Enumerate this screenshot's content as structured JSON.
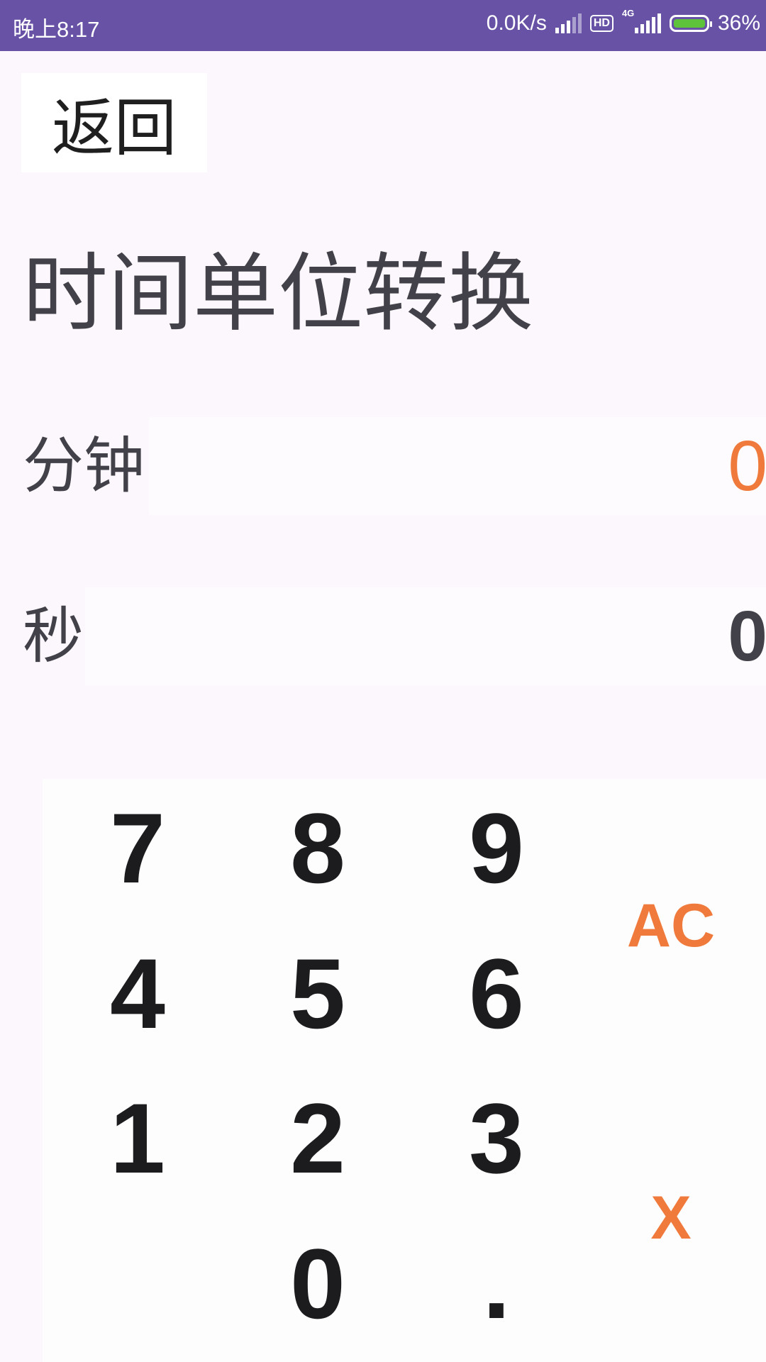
{
  "status_bar": {
    "time": "晚上8:17",
    "net_speed": "0.0K/s",
    "hd": "HD",
    "network": "4G",
    "battery": "36%",
    "battery_color": "#5ec23a"
  },
  "header": {
    "back_label": "返回",
    "title": "时间单位转换"
  },
  "fields": {
    "minutes_label": "分钟",
    "minutes_value": "0",
    "seconds_label": "秒",
    "seconds_value": "0"
  },
  "keypad": {
    "digits": [
      "7",
      "8",
      "9",
      "4",
      "5",
      "6",
      "1",
      "2",
      "3",
      "0",
      "."
    ],
    "clear_label": "AC",
    "delete_label": "X"
  },
  "colors": {
    "statusbar": "#6852a6",
    "accent": "#f07a3c",
    "text": "#424048"
  }
}
